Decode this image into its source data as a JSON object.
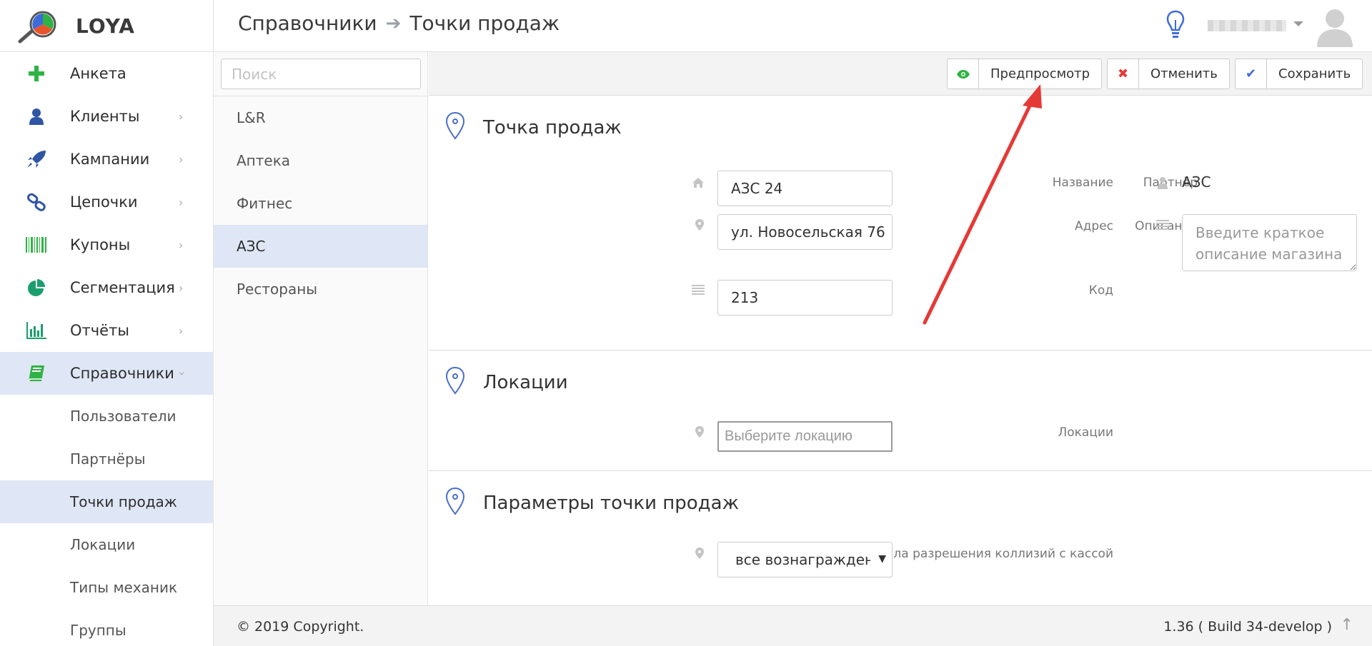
{
  "app": {
    "name": "LOYA",
    "breadcrumb": [
      "Справочники",
      "Точки продаж"
    ]
  },
  "sidebar": {
    "items": [
      {
        "label": "Анкета",
        "icon": "plus-icon",
        "color": "#2fb344"
      },
      {
        "label": "Клиенты",
        "icon": "user-icon",
        "color": "#2f55a4"
      },
      {
        "label": "Кампании",
        "icon": "rocket-icon",
        "color": "#2f55a4"
      },
      {
        "label": "Цепочки",
        "icon": "link-icon",
        "color": "#2f55a4"
      },
      {
        "label": "Купоны",
        "icon": "barcode-icon",
        "color": "#2fb344"
      },
      {
        "label": "Сегментация",
        "icon": "pie-chart-icon",
        "color": "#1b9e6e"
      },
      {
        "label": "Отчёты",
        "icon": "bar-chart-icon",
        "color": "#1b9e6e"
      },
      {
        "label": "Справочники",
        "icon": "book-icon",
        "color": "#2fb344"
      }
    ],
    "subitems": [
      "Пользователи",
      "Партнёры",
      "Точки продаж",
      "Локации",
      "Типы механик",
      "Группы"
    ]
  },
  "list": {
    "search_placeholder": "Поиск",
    "items": [
      "L&R",
      "Аптека",
      "Фитнес",
      "АЗС",
      "Рестораны"
    ]
  },
  "toolbar": {
    "preview": "Предпросмотр",
    "cancel": "Отменить",
    "save": "Сохранить"
  },
  "sections": {
    "point": {
      "title": "Точка продаж",
      "name_label": "Название",
      "name_value": "АЗС 24",
      "address_label": "Адрес",
      "address_value": "ул. Новосельская 76",
      "code_label": "Код",
      "code_value": "213",
      "partner_label": "Партнёр",
      "partner_value": "АЗС",
      "description_label": "Описание",
      "description_placeholder": "Введите краткое описание магазина"
    },
    "locations": {
      "title": "Локации",
      "label": "Локации",
      "placeholder": "Выберите локацию"
    },
    "params": {
      "title": "Параметры точки продаж",
      "collision_label": "Правила разрешения коллизий с кассой",
      "collision_value": "все вознагражден"
    }
  },
  "footer": {
    "copyright": "© 2019 Copyright.",
    "version": "1.36 ( Build 34-develop )"
  },
  "colors": {
    "accent_blue": "#4a6fc9",
    "active_bg": "#dfe6f5",
    "annotation_red": "#e53935"
  }
}
